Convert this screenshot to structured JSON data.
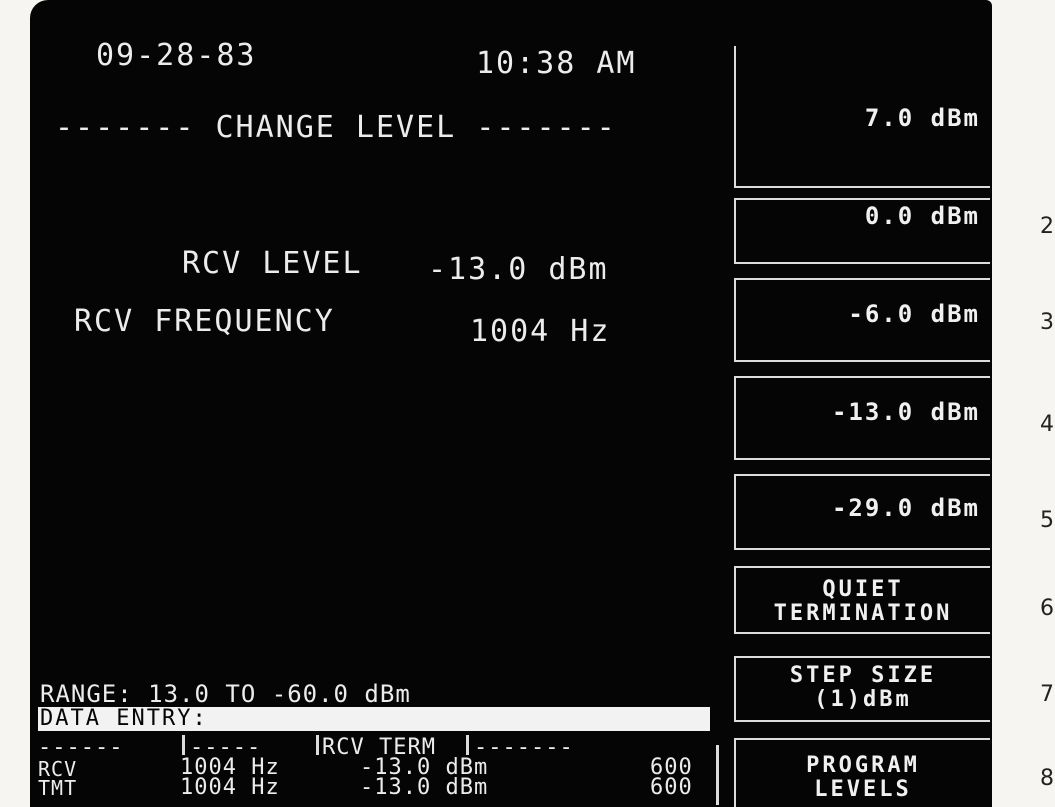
{
  "header": {
    "date": "09-28-83",
    "time": "10:38 AM",
    "title": "------- CHANGE LEVEL -------"
  },
  "readings": {
    "level_label": "RCV LEVEL",
    "level_value": "-13.0 dBm",
    "frequency_label": "RCV FREQUENCY",
    "frequency_value": "1004 Hz"
  },
  "entry": {
    "range": "RANGE: 13.0 TO -60.0 dBm",
    "data_entry_label": "DATA ENTRY:"
  },
  "status": {
    "divider_left": "------",
    "divider_mid": "-----",
    "term_label": "RCV TERM",
    "divider_right": "-------",
    "rows": [
      {
        "name": "RCV",
        "freq": "1004 Hz",
        "level": "-13.0 dBm",
        "imp": "600"
      },
      {
        "name": "TMT",
        "freq": "1004 Hz",
        "level": "-13.0 dBm",
        "imp": "600"
      }
    ]
  },
  "softkeys": {
    "k1": "7.0 dBm",
    "k2": "0.0 dBm",
    "k3": "-6.0 dBm",
    "k4": "-13.0 dBm",
    "k5": "-29.0 dBm",
    "k6_line1": "QUIET",
    "k6_line2": "TERMINATION",
    "k7_line1": "STEP SIZE",
    "k7_line2": "(1)dBm",
    "k8_line1": "PROGRAM",
    "k8_line2": "LEVELS"
  },
  "key_numbers": [
    "2",
    "3",
    "4",
    "5",
    "6",
    "7",
    "8"
  ]
}
